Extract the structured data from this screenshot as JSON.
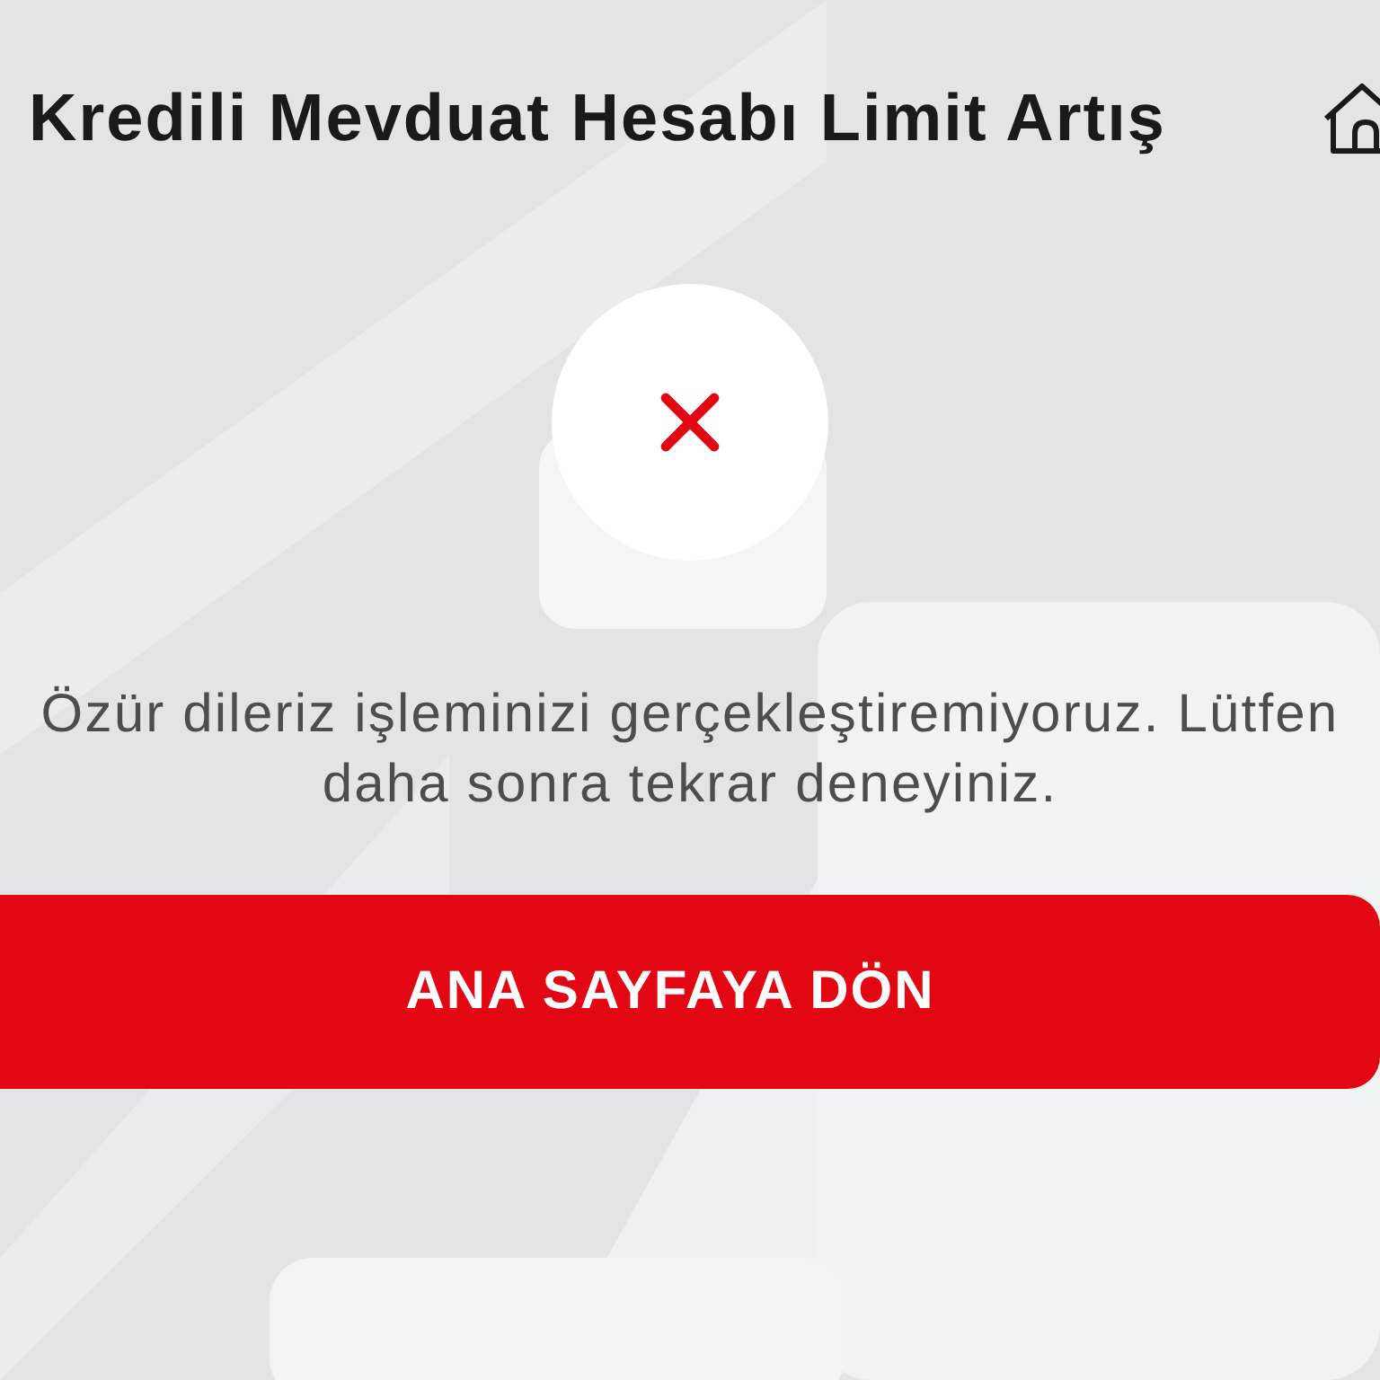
{
  "header": {
    "title": "Kredili Mevduat Hesabı Limit Artış"
  },
  "status": {
    "kind": "error"
  },
  "message": "Özür dileriz işleminizi gerçekleştiremiyoruz. Lütfen daha sonra tekrar deneyiniz.",
  "button": {
    "label": "ANA SAYFAYA DÖN"
  }
}
